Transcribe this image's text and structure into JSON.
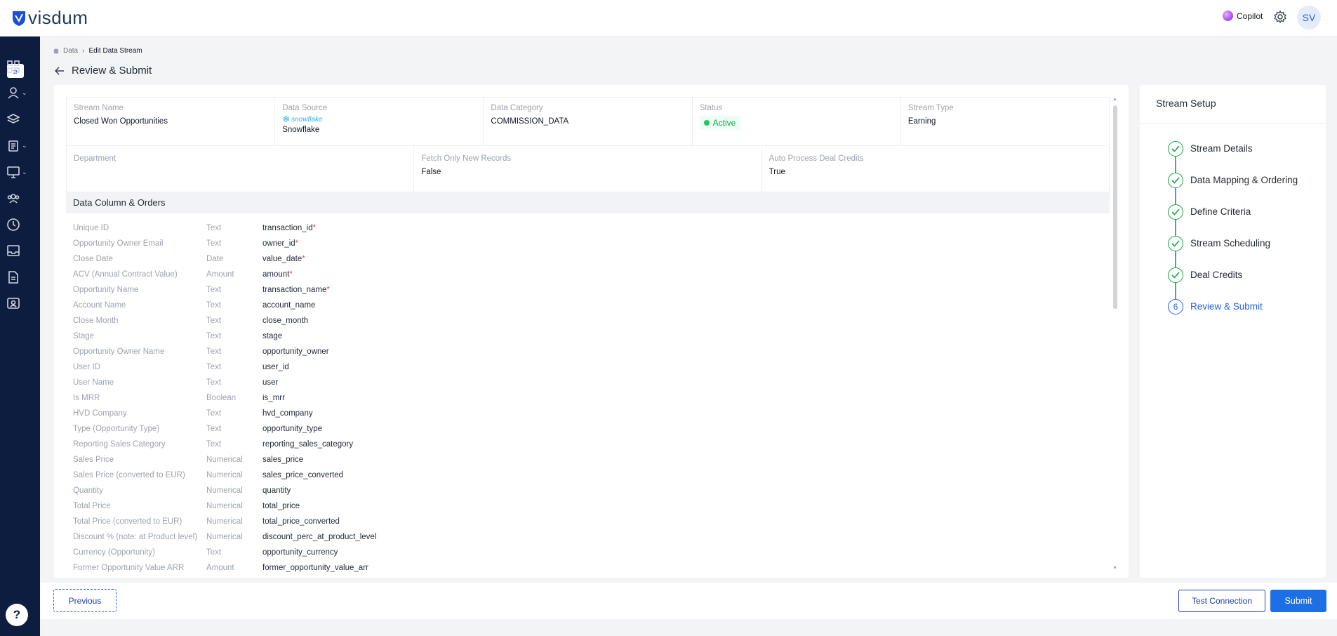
{
  "header": {
    "brand": "visdum",
    "copilot_label": "Copilot",
    "avatar_initials": "SV"
  },
  "breadcrumb": {
    "root": "Data",
    "current": "Edit Data Stream"
  },
  "page_title": "Review & Submit",
  "summary": {
    "stream_name_label": "Stream Name",
    "stream_name": "Closed Won Opportunities",
    "data_source_label": "Data Source",
    "data_source_logo_text": "snowflake",
    "data_source": "Snowflake",
    "data_category_label": "Data Category",
    "data_category": "COMMISSION_DATA",
    "status_label": "Status",
    "status": "Active",
    "stream_type_label": "Stream Type",
    "stream_type": "Earning",
    "department_label": "Department",
    "department": "",
    "fetch_only_new_label": "Fetch Only New Records",
    "fetch_only_new": "False",
    "auto_process_label": "Auto Process Deal Credits",
    "auto_process": "True"
  },
  "columns_section_title": "Data Column & Orders",
  "columns": [
    {
      "name": "Unique ID",
      "type": "Text",
      "field": "transaction_id",
      "required": "*"
    },
    {
      "name": "Opportunity Owner Email",
      "type": "Text",
      "field": "owner_id",
      "required": "*"
    },
    {
      "name": "Close Date",
      "type": "Date",
      "field": "value_date",
      "required": "*"
    },
    {
      "name": "ACV (Annual Contract Value)",
      "type": "Amount",
      "field": "amount",
      "required": "*"
    },
    {
      "name": "Opportunity Name",
      "type": "Text",
      "field": "transaction_name",
      "required": "*"
    },
    {
      "name": "Account Name",
      "type": "Text",
      "field": "account_name",
      "required": ""
    },
    {
      "name": "Close Month",
      "type": "Text",
      "field": "close_month",
      "required": ""
    },
    {
      "name": "Stage",
      "type": "Text",
      "field": "stage",
      "required": ""
    },
    {
      "name": "Opportunity Owner Name",
      "type": "Text",
      "field": "opportunity_owner",
      "required": ""
    },
    {
      "name": "User ID",
      "type": "Text",
      "field": "user_id",
      "required": ""
    },
    {
      "name": "User Name",
      "type": "Text",
      "field": "user",
      "required": ""
    },
    {
      "name": "Is MRR",
      "type": "Boolean",
      "field": "is_mrr",
      "required": ""
    },
    {
      "name": "HVD Company",
      "type": "Text",
      "field": "hvd_company",
      "required": ""
    },
    {
      "name": "Type (Opportunity Type)",
      "type": "Text",
      "field": "opportunity_type",
      "required": ""
    },
    {
      "name": "Reporting Sales Category",
      "type": "Text",
      "field": "reporting_sales_category",
      "required": ""
    },
    {
      "name": "Sales Price",
      "type": "Numerical",
      "field": "sales_price",
      "required": ""
    },
    {
      "name": "Sales Price (converted to EUR)",
      "type": "Numerical",
      "field": "sales_price_converted",
      "required": ""
    },
    {
      "name": "Quantity",
      "type": "Numerical",
      "field": "quantity",
      "required": ""
    },
    {
      "name": "Total Price",
      "type": "Numerical",
      "field": "total_price",
      "required": ""
    },
    {
      "name": "Total Price (converted to EUR)",
      "type": "Numerical",
      "field": "total_price_converted",
      "required": ""
    },
    {
      "name": "Discount % (note: at Product level)",
      "type": "Numerical",
      "field": "discount_perc_at_product_level",
      "required": ""
    },
    {
      "name": "Currency (Opportunity)",
      "type": "Text",
      "field": "opportunity_currency",
      "required": ""
    },
    {
      "name": "Former Opportunity Value ARR",
      "type": "Amount",
      "field": "former_opportunity_value_arr",
      "required": ""
    }
  ],
  "stream_setup": {
    "title": "Stream Setup",
    "steps": [
      {
        "label": "Stream Details",
        "state": "done"
      },
      {
        "label": "Data Mapping & Ordering",
        "state": "done"
      },
      {
        "label": "Define Criteria",
        "state": "done"
      },
      {
        "label": "Stream Scheduling",
        "state": "done"
      },
      {
        "label": "Deal Credits",
        "state": "done"
      },
      {
        "label": "Review & Submit",
        "state": "current",
        "number": "6"
      }
    ]
  },
  "footer": {
    "previous_label": "Previous",
    "test_connection_label": "Test Connection",
    "submit_label": "Submit"
  },
  "help_label": "?",
  "colors": {
    "sidebar_bg": "#0d1d3f",
    "primary": "#1d6fe5",
    "success": "#22c55e",
    "required": "#ef4444"
  },
  "sidebar_icons": [
    "dashboard-icon",
    "user-icon",
    "layers-icon",
    "clipboard-icon",
    "monitor-icon",
    "team-icon",
    "clock-icon",
    "inbox-icon",
    "document-icon",
    "id-card-icon"
  ]
}
